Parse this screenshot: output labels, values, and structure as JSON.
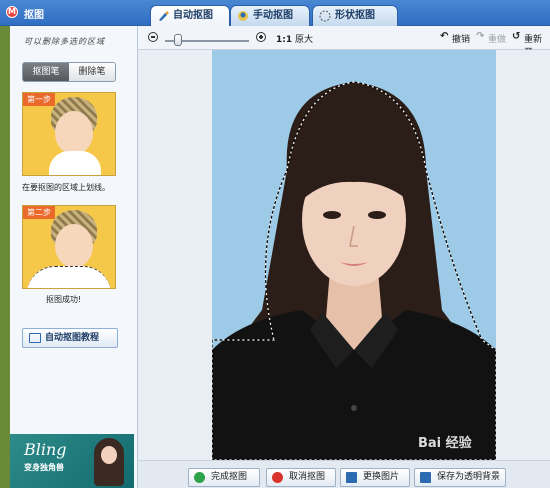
{
  "window": {
    "title": "抠图"
  },
  "tabs": [
    {
      "label": "自动抠图",
      "icon": "brush-icon",
      "active": true
    },
    {
      "label": "手动抠图",
      "icon": "cutout-icon",
      "active": false
    },
    {
      "label": "形状抠图",
      "icon": "shape-icon",
      "active": false
    }
  ],
  "sidebar": {
    "hint": "可以删除多选的区域",
    "brush_tabs": [
      "抠图笔",
      "删除笔"
    ],
    "step1": {
      "label": "第一步",
      "caption": "在要抠图的区域上划线。"
    },
    "step2": {
      "label": "第二步",
      "caption": "抠图成功!"
    },
    "tutorial_button": "自动抠图教程",
    "banner": {
      "title": "Bling",
      "subtitle": "变身独角兽"
    }
  },
  "toolbar": {
    "zoom_ratio": "1:1",
    "zoom_label": "原大",
    "undo": "撤销",
    "redo": "重做",
    "restart": "重新开"
  },
  "bottom_buttons": [
    {
      "label": "完成抠图",
      "icon": "check-icon",
      "color": "#2ea34a"
    },
    {
      "label": "取消抠图",
      "icon": "cancel-icon",
      "color": "#d9342b"
    },
    {
      "label": "更换图片",
      "icon": "image-icon",
      "color": "#2c6ab2"
    },
    {
      "label": "保存为透明背景",
      "icon": "save-icon",
      "color": "#2c6ab2"
    }
  ],
  "watermark": "Bai 经验",
  "colors": {
    "titlebar": "#3b7dcc",
    "photo_bg": "#9dcae6",
    "step_bg": "#f6c84a"
  }
}
